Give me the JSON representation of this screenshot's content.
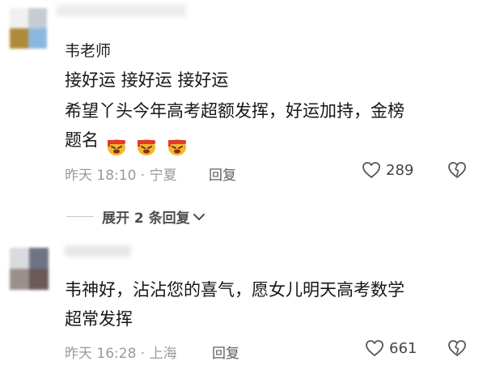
{
  "comments": [
    {
      "username": "韦老师",
      "lines": [
        "接好运 接好运 接好运",
        "希望丫头今年高考超额发挥，好运加持，金榜",
        "题名"
      ],
      "emoji_count": 3,
      "meta": "昨天 18:10 · 宁夏",
      "reply_label": "回复",
      "likes": "289"
    },
    {
      "username": "",
      "lines": [
        "韦神好，沾沾您的喜气，愿女儿明天高考数学",
        "超常发挥"
      ],
      "meta": "昨天 16:28 · 上海",
      "reply_label": "回复",
      "likes": "661"
    }
  ],
  "expand_label": "展开 2 条回复",
  "icons": {
    "like": "heart-outline-icon",
    "dislike": "broken-heart-icon",
    "expand": "chevron-down-icon",
    "emoji": "cheering-headband-emoji"
  },
  "colors": {
    "text": "#161616",
    "meta": "#9a9a9a",
    "reply": "#5f5f5f",
    "emoji_face": "#f5b52e",
    "emoji_band": "#e23a2a"
  }
}
